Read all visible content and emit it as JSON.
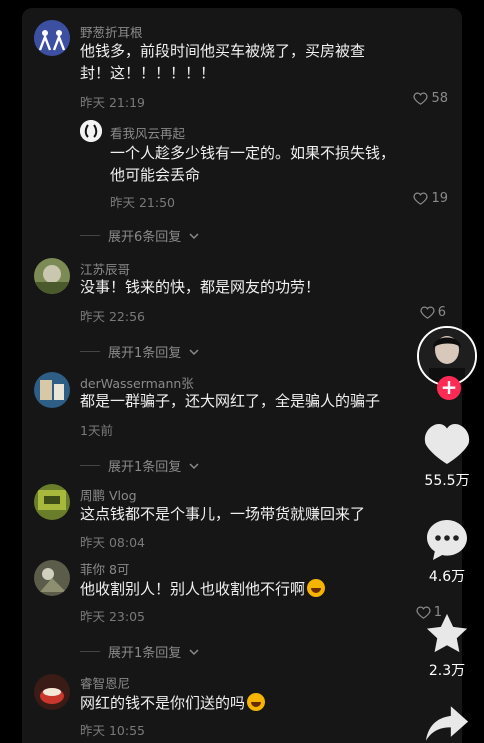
{
  "comments": [
    {
      "user": "野葱折耳根",
      "text": "他钱多，前段时间他买车被烧了，买房被查封！这！！！！！！",
      "time": "昨天 21:19",
      "likes": "58"
    },
    {
      "user": "看我风云再起",
      "text": "一个人趁多少钱有一定的。如果不损失钱，他可能会丢命",
      "time": "昨天 21:50",
      "likes": "19"
    },
    {
      "user": "江苏辰哥",
      "text": "没事！钱来的快，都是网友的功劳！",
      "time": "昨天 22:56",
      "likes": "6"
    },
    {
      "user": "derWassermann张",
      "text": "都是一群骗子，还大网红了，全是骗人的骗子",
      "time": "1天前",
      "likes": ""
    },
    {
      "user": "周鹏 Vlog",
      "text": "这点钱都不是个事儿，一场带货就赚回来了",
      "time": "昨天 08:04",
      "likes": ""
    },
    {
      "user": "菲你 8可",
      "text": "他收割别人！别人也收割他不行啊",
      "time": "昨天 23:05",
      "likes": "1"
    },
    {
      "user": "睿智恩尼",
      "text": "网红的钱不是你们送的吗",
      "time": "昨天 10:55",
      "likes": ""
    }
  ],
  "expand_labels": {
    "replies_6": "展开6条回复",
    "replies_1": "展开1条回复"
  },
  "sidebar": {
    "likes": "55.5万",
    "comments": "4.6万",
    "favorites": "2.3万"
  },
  "colors": {
    "follow": "#ff2b54",
    "panel": "#161616"
  }
}
